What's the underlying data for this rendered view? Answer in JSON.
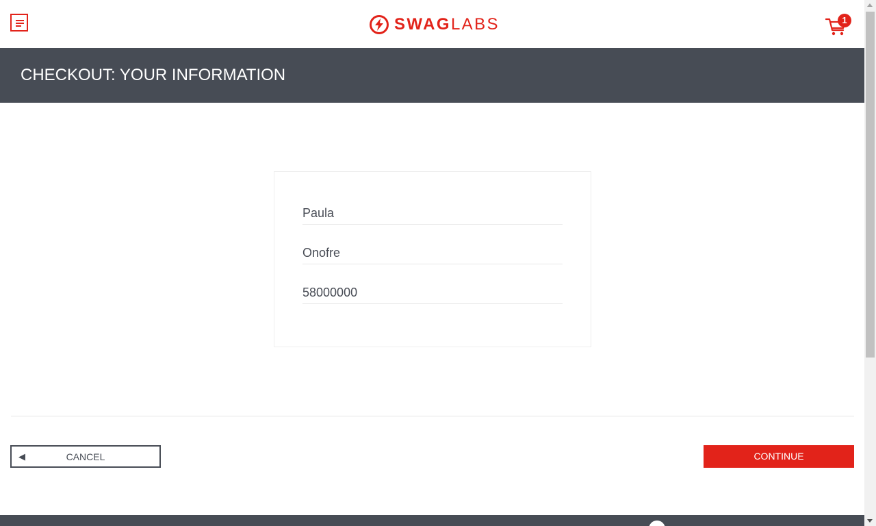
{
  "header": {
    "logo_bold": "SWAG",
    "logo_light": "LABS",
    "menu_icon": "hamburger-menu-icon",
    "cart_icon": "shopping-cart-icon",
    "cart_count": "1"
  },
  "secondary_header": {
    "title": "CHECKOUT: YOUR INFORMATION"
  },
  "form": {
    "first_name": "Paula",
    "last_name": "Onofre",
    "postal_code": "58000000"
  },
  "actions": {
    "cancel_arrow": "◀",
    "cancel_label": "CANCEL",
    "continue_label": "CONTINUE"
  },
  "colors": {
    "brand": "#e2231a",
    "header_bg": "#474c55"
  }
}
